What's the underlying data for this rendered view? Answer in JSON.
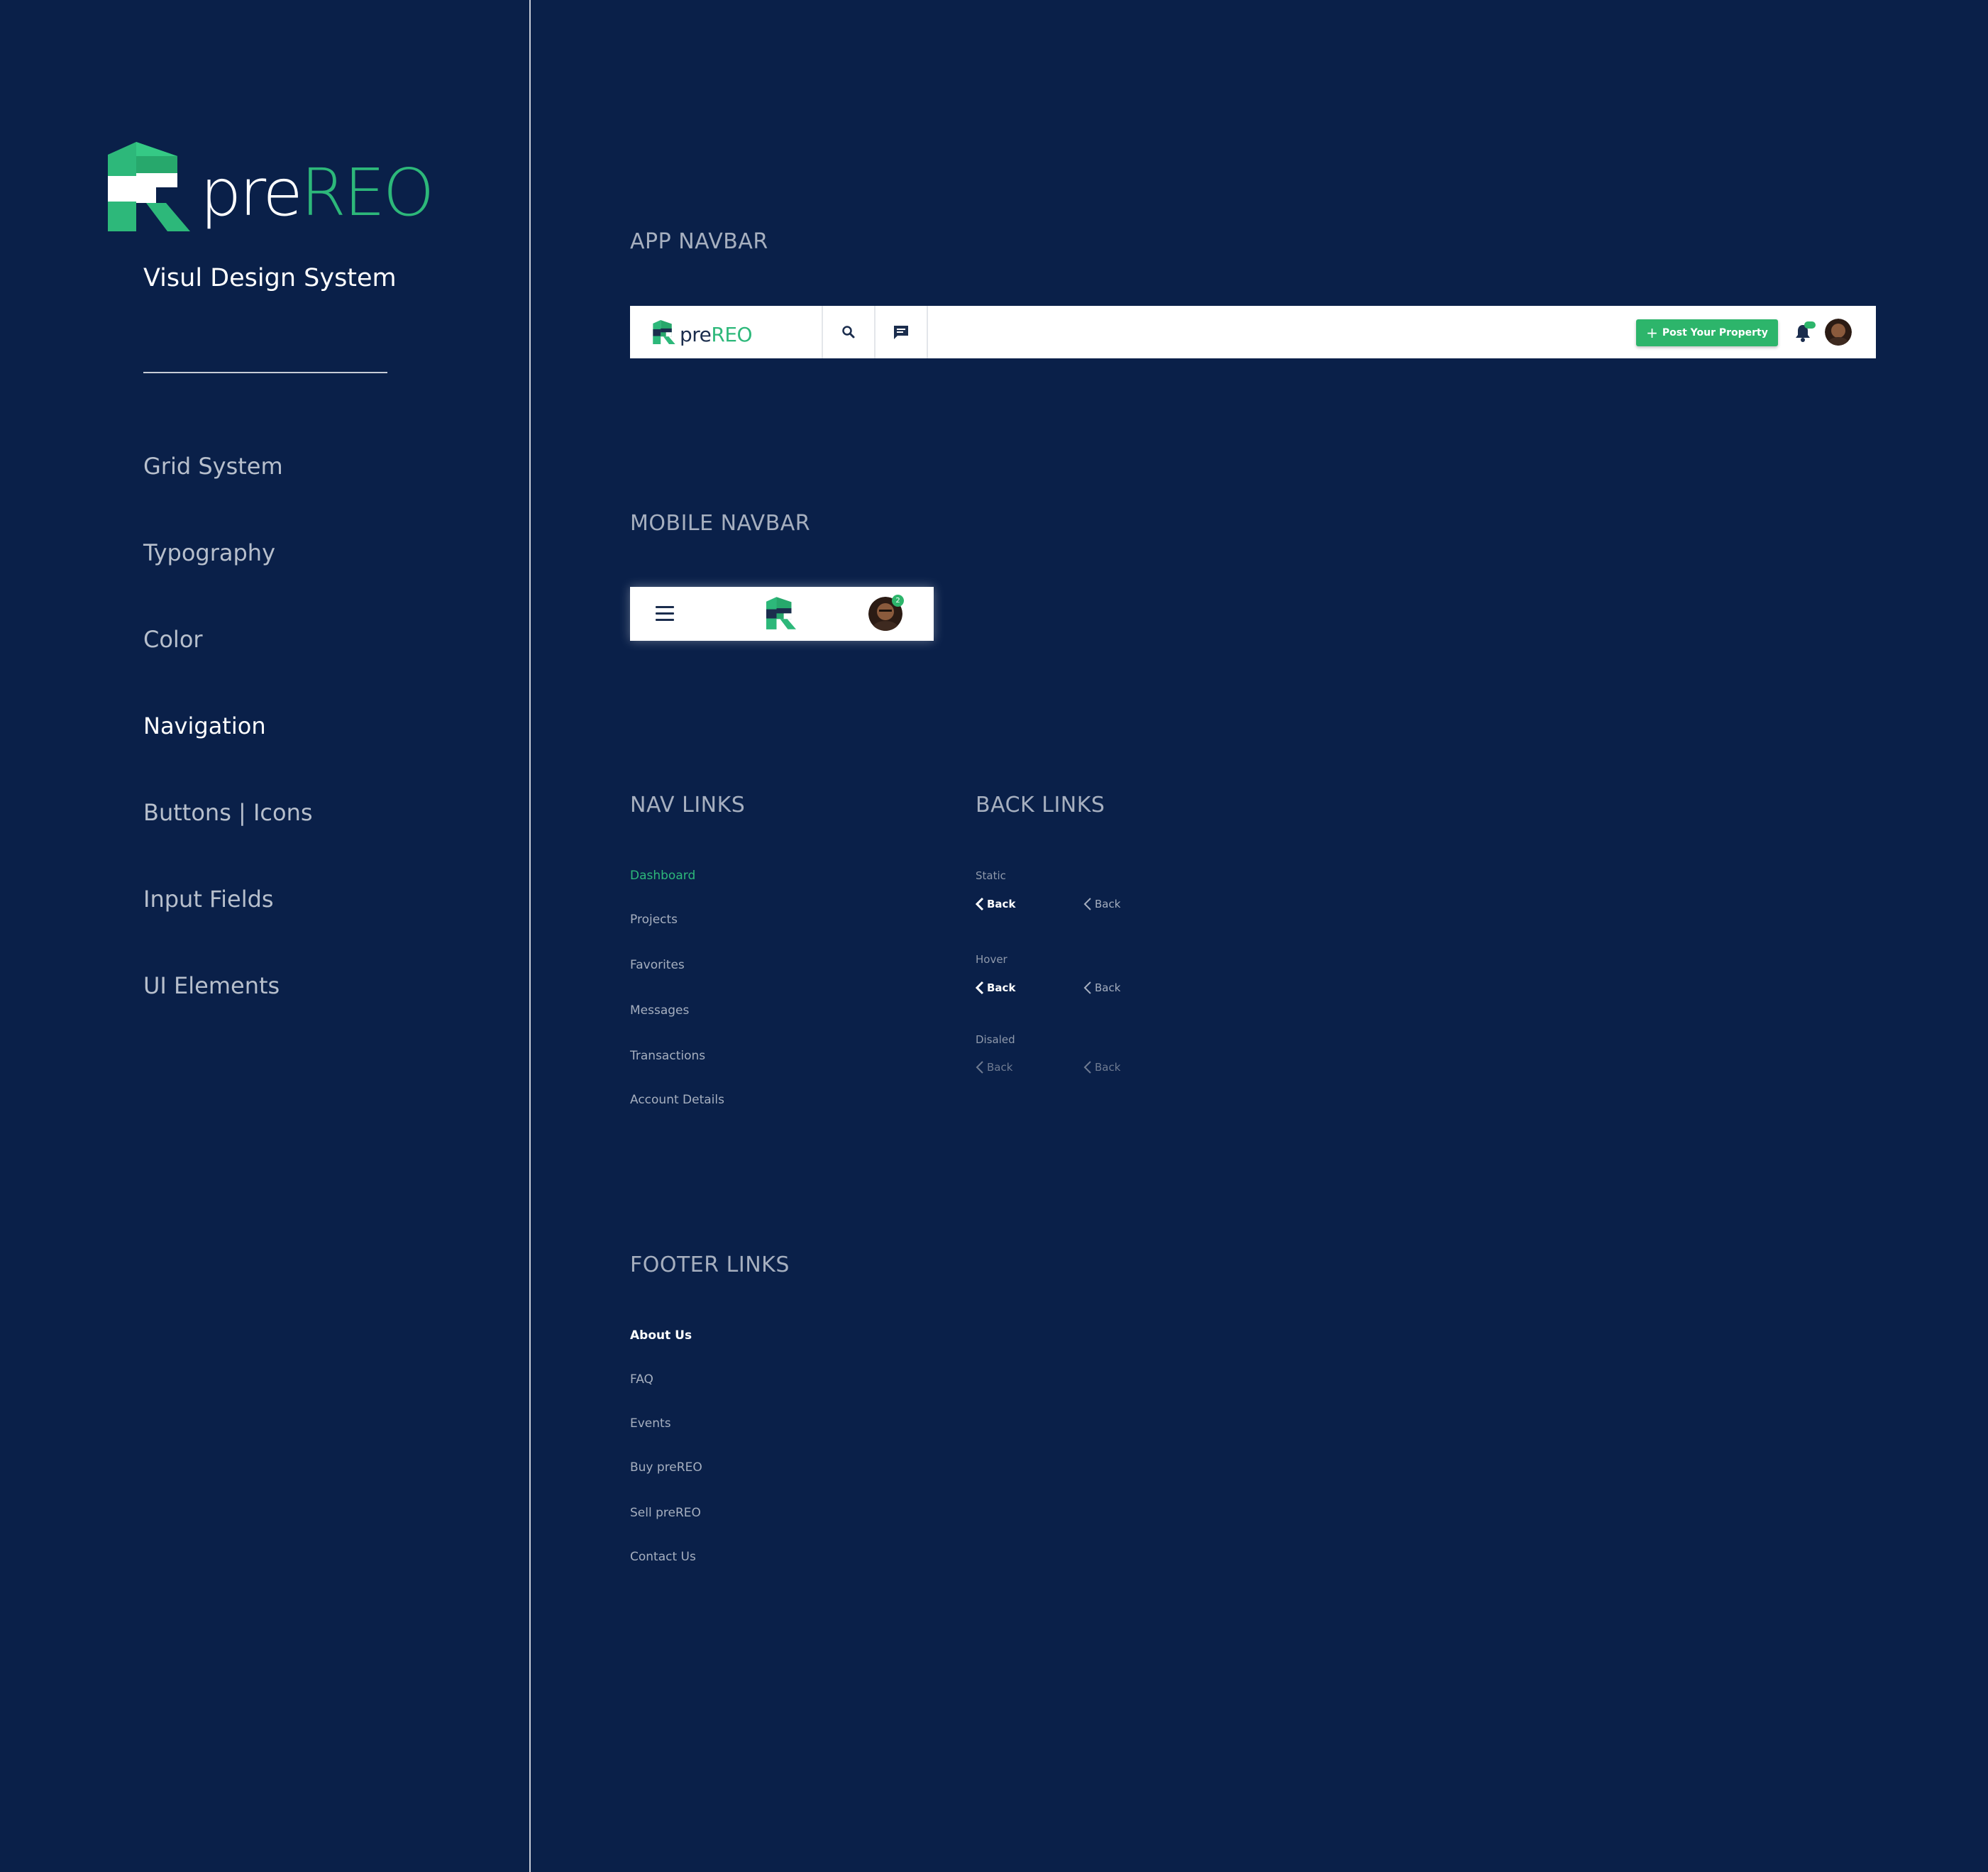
{
  "brand": {
    "pre": "pre",
    "reo": "REO",
    "green": "#2db87a",
    "navy": "#0a2049"
  },
  "sidebar": {
    "tagline": "Visul Design System",
    "items": [
      {
        "label": "Grid System",
        "active": false
      },
      {
        "label": "Typography",
        "active": false
      },
      {
        "label": "Color",
        "active": false
      },
      {
        "label": "Navigation",
        "active": true
      },
      {
        "label": "Buttons | Icons",
        "active": false
      },
      {
        "label": "Input Fields",
        "active": false
      },
      {
        "label": "UI Elements",
        "active": false
      }
    ]
  },
  "sections": {
    "app_navbar": "APP NAVBAR",
    "mobile_navbar": "MOBILE NAVBAR",
    "nav_links": "NAV LINKS",
    "back_links": "BACK LINKS",
    "footer_links": "FOOTER LINKS"
  },
  "app_navbar": {
    "brand_pre": "pre",
    "brand_reo": "REO",
    "icons": [
      "search-icon",
      "message-icon",
      "bell-icon"
    ],
    "post_button": "Post Your Property",
    "notification_badge": "2"
  },
  "mobile_navbar": {
    "icons": [
      "menu-icon",
      "logo-mark-icon",
      "avatar"
    ],
    "badge": "2"
  },
  "nav_links": [
    {
      "label": "Dashboard",
      "active": true
    },
    {
      "label": "Projects",
      "active": false
    },
    {
      "label": "Favorites",
      "active": false
    },
    {
      "label": "Messages",
      "active": false
    },
    {
      "label": "Transactions",
      "active": false
    },
    {
      "label": "Account Details",
      "active": false
    }
  ],
  "back_links": {
    "states": [
      {
        "label": "Static",
        "primary": "Back",
        "secondary": "Back"
      },
      {
        "label": "Hover",
        "primary": "Back",
        "secondary": "Back"
      },
      {
        "label": "Disaled",
        "primary": "Back",
        "secondary": "Back"
      }
    ]
  },
  "footer_links": [
    {
      "label": "About Us",
      "active": true
    },
    {
      "label": "FAQ",
      "active": false
    },
    {
      "label": "Events",
      "active": false
    },
    {
      "label": "Buy preREO",
      "active": false
    },
    {
      "label": "Sell preREO",
      "active": false
    },
    {
      "label": "Contact Us",
      "active": false
    }
  ]
}
